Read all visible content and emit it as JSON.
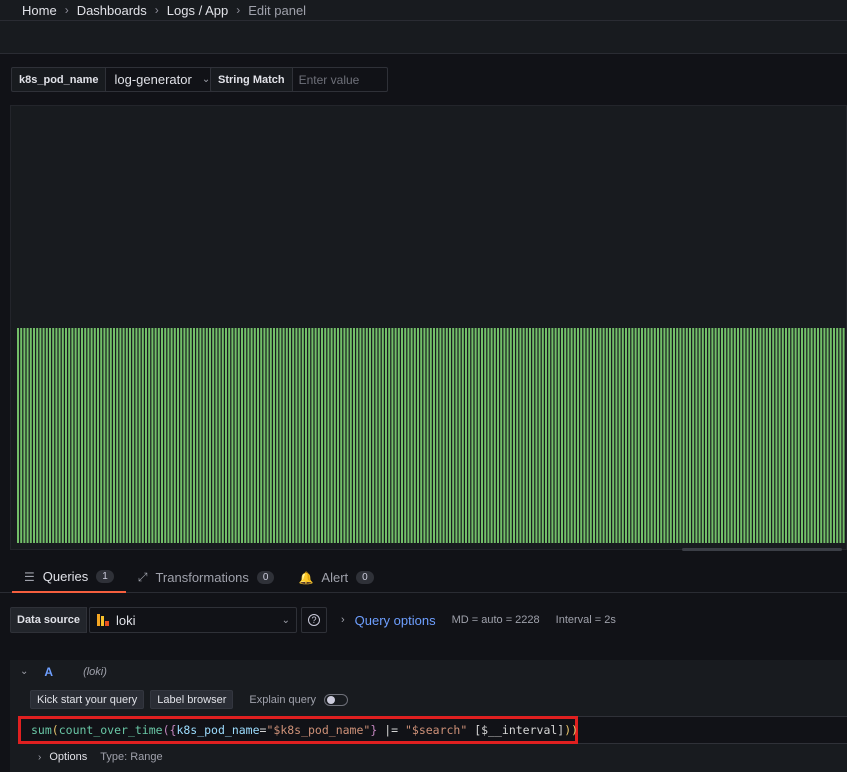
{
  "breadcrumb": {
    "items": [
      "Home",
      "Dashboards",
      "Logs / App",
      "Edit panel"
    ],
    "separator": "›"
  },
  "variables": {
    "pod": {
      "label": "k8s_pod_name",
      "value": "log-generator"
    },
    "search": {
      "label": "String Match",
      "placeholder": "Enter value"
    }
  },
  "panel": {
    "bar_color": "#73bf69",
    "bar_level": 0.49
  },
  "tabs": [
    {
      "label": "Queries",
      "count": "1",
      "icon": "database-icon"
    },
    {
      "label": "Transformations",
      "count": "0",
      "icon": "transform-icon"
    },
    {
      "label": "Alert",
      "count": "0",
      "icon": "bell-icon"
    }
  ],
  "datasource": {
    "label": "Data source",
    "value": "loki",
    "query_options": "Query options",
    "md": "MD = auto = 2228",
    "interval": "Interval = 2s"
  },
  "query": {
    "ref": "A",
    "ds": "(loki)",
    "kick_start": "Kick start your query",
    "label_browser": "Label browser",
    "explain": "Explain query",
    "options": "Options",
    "type": "Type: Range",
    "expr": {
      "fn1": "sum",
      "p1": "(",
      "fn2": "count_over_time",
      "p2": "({",
      "label": "k8s_pod_name",
      "eq": "=",
      "value": "\"$k8s_pod_name\"",
      "p3": "}",
      "op": " |= ",
      "search": "\"$search\"",
      "range": " [$__interval]",
      "p4": "))"
    }
  }
}
